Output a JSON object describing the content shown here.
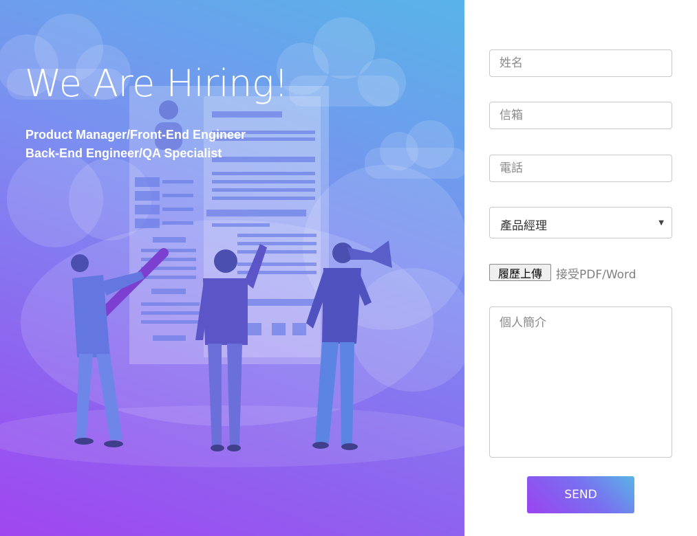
{
  "hero": {
    "title": "We Are Hiring!",
    "subtitle_lines": [
      "Product Manager/Front-End Engineer",
      "Back-End Engineer/QA Specialist"
    ],
    "illustration": "hiring-team-illustration"
  },
  "form": {
    "name_placeholder": "姓名",
    "email_placeholder": "信箱",
    "phone_placeholder": "電話",
    "position_selected": "產品經理",
    "resume_button_label": "履歷上傳",
    "resume_note": "接受PDF/Word",
    "bio_placeholder": "個人簡介",
    "send_label": "SEND"
  },
  "colors": {
    "gradient_top": "#58b4e8",
    "gradient_bottom": "#a046f0",
    "border": "#c8c8c8"
  }
}
